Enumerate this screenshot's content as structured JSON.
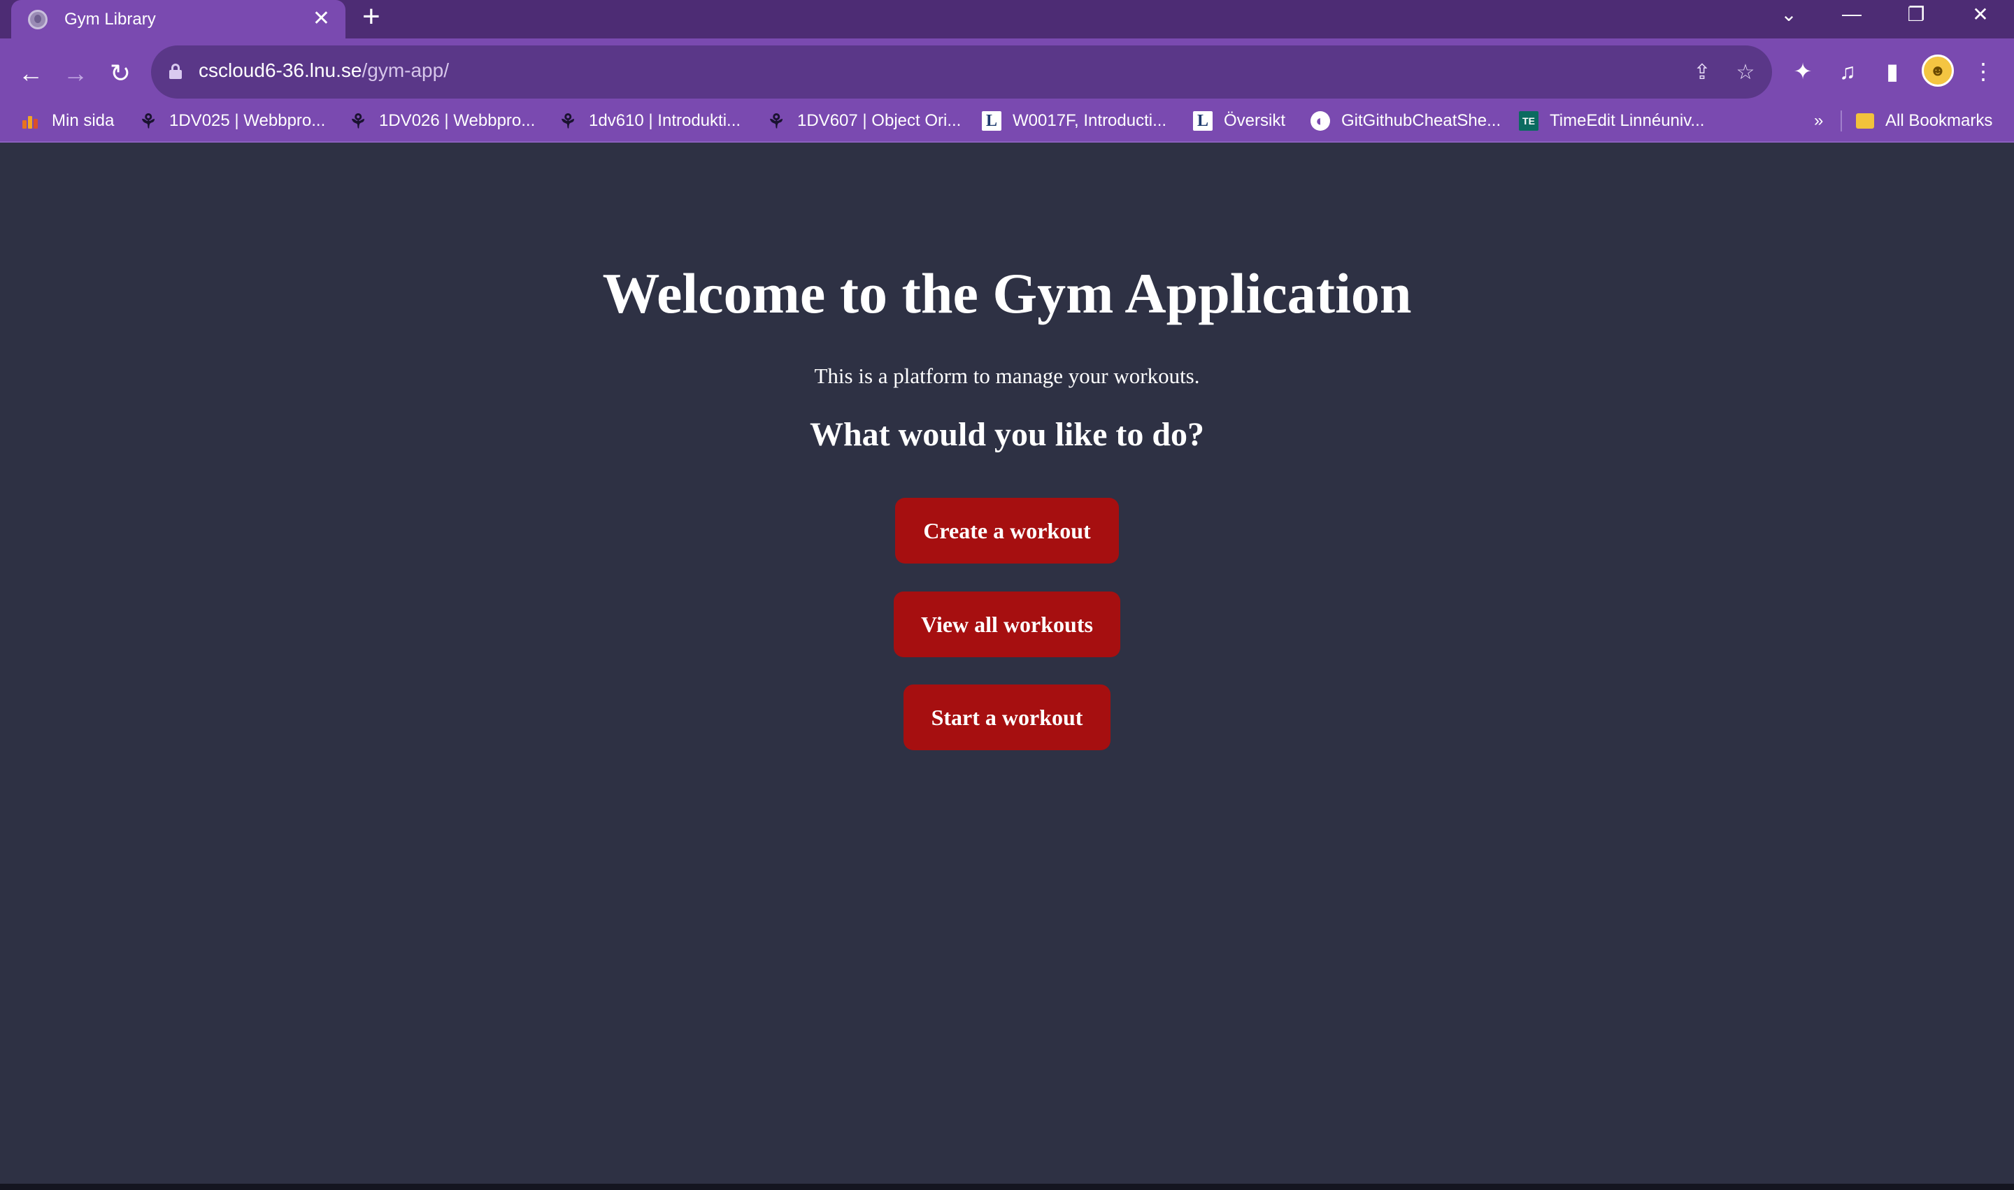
{
  "browser": {
    "tab_title": "Gym Library",
    "tab_close": "✕",
    "new_tab": "+",
    "url_host": "cscloud6-36.lnu.se",
    "url_path": "/gym-app/",
    "window_controls": {
      "tab_search": "⌄",
      "minimize": "—",
      "restore": "❐",
      "close": "✕"
    },
    "nav": {
      "back": "←",
      "forward": "→",
      "reload": "↻"
    },
    "toolbar_icons": {
      "share": "⇪",
      "star": "☆",
      "extensions": "✦",
      "media": "♫",
      "sidepanel": "▮",
      "menu": "⋮"
    }
  },
  "bookmarks": {
    "items": [
      {
        "label": "Min sida",
        "icon": "min-sida-icon"
      },
      {
        "label": "1DV025 | Webbpro...",
        "icon": "tree-icon"
      },
      {
        "label": "1DV026 | Webbpro...",
        "icon": "tree-icon"
      },
      {
        "label": "1dv610 | Introdukti...",
        "icon": "tree-icon"
      },
      {
        "label": "1DV607 | Object Ori...",
        "icon": "tree-icon"
      },
      {
        "label": "W0017F, Introducti...",
        "icon": "lnu-icon"
      },
      {
        "label": "Översikt",
        "icon": "lnu-icon"
      },
      {
        "label": "GitGithubCheatShe...",
        "icon": "globe-icon"
      },
      {
        "label": "TimeEdit Linnéuniv...",
        "icon": "timeedit-icon"
      }
    ],
    "overflow": "»",
    "all_bookmarks": "All Bookmarks",
    "icon_glyphs": {
      "tree": "⚘",
      "lnu": "L",
      "globe": "◐",
      "timeedit": "TE"
    }
  },
  "page": {
    "heading": "Welcome to the Gym Application",
    "description": "This is a platform to manage your workouts.",
    "question": "What would you like to do?",
    "buttons": {
      "create": "Create a workout",
      "view": "View all workouts",
      "start": "Start a workout"
    }
  },
  "colors": {
    "background": "#2e3144",
    "button": "#a60f10",
    "browser_frame": "#7a4ab0"
  }
}
